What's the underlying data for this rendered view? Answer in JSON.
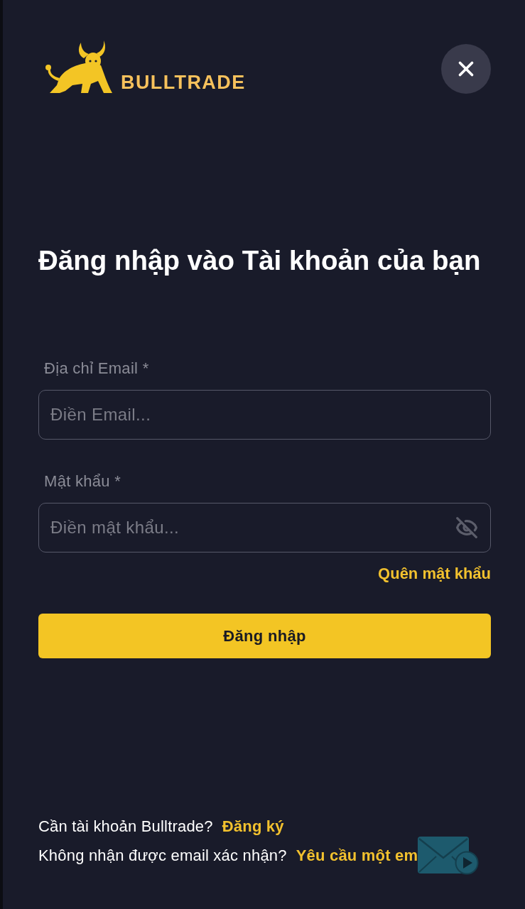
{
  "logo": {
    "text": "BULLTRADE"
  },
  "title": "Đăng nhập vào Tài khoản của bạn",
  "form": {
    "fields": [
      {
        "kind": "email",
        "label": "Địa chỉ Email *",
        "placeholder": "Điền Email..."
      },
      {
        "kind": "password",
        "label": "Mật khẩu *",
        "placeholder": "Điền mật khẩu...",
        "password_visible": false
      }
    ],
    "forgot_link": "Quên mật khẩu",
    "submit": "Đăng nhập"
  },
  "footer": [
    {
      "text": "Cần tài khoản Bulltrade?",
      "link": "Đăng ký"
    },
    {
      "text": "Không nhận được email xác nhận?",
      "link": "Yêu cầu một em"
    }
  ]
}
